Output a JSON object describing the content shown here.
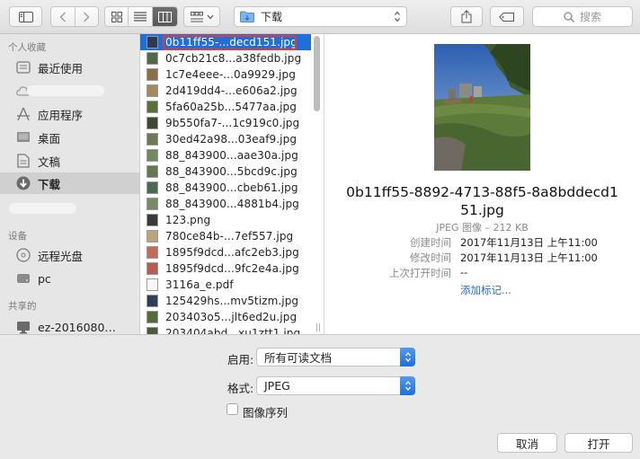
{
  "toolbar": {
    "sidebar_toggle_icon": "sidebar-icon",
    "back_icon": "chevron-left-icon",
    "forward_icon": "chevron-right-icon",
    "view_icons": [
      "icon-view-icon",
      "list-view-icon",
      "column-view-icon"
    ],
    "active_view": "column-view-icon",
    "group_icon": "grid-group-icon",
    "location": "下载",
    "share_icon": "share-icon",
    "tag_icon": "tag-icon",
    "search_placeholder": "搜索"
  },
  "sidebar": {
    "favorites_header": "个人收藏",
    "favorites": [
      {
        "label": "最近使用",
        "icon": "recents-icon"
      },
      {
        "label": "",
        "icon": "cloud-icon"
      },
      {
        "label": "应用程序",
        "icon": "applications-icon"
      },
      {
        "label": "桌面",
        "icon": "desktop-icon"
      },
      {
        "label": "文稿",
        "icon": "documents-icon"
      },
      {
        "label": "下载",
        "icon": "downloads-icon",
        "selected": true
      }
    ],
    "devices_header": "设备",
    "devices": [
      {
        "label": "远程光盘",
        "icon": "disc-icon"
      },
      {
        "label": "pc",
        "icon": "drive-icon"
      }
    ],
    "shared_header": "共享的",
    "shared": [
      {
        "label": "ez-2016080…",
        "icon": "monitor-icon"
      }
    ]
  },
  "files": [
    {
      "name": "0b11ff55-...decd151.jpg",
      "selected": true,
      "thumb": "#2c3a55"
    },
    {
      "name": "0c7cb21c8...a38fedb.jpg",
      "thumb": "#4f6b45"
    },
    {
      "name": "1c7e4eee-...0a9929.jpg",
      "thumb": "#8a6f4a"
    },
    {
      "name": "2d419dd4-...e606a2.jpg",
      "thumb": "#a48a5e"
    },
    {
      "name": "5fa60a25b...5477aa.jpg",
      "thumb": "#5b6f3a"
    },
    {
      "name": "9b550fa7-...1c919c0.jpg",
      "thumb": "#3d4a30"
    },
    {
      "name": "30ed42a98...03eaf9.jpg",
      "thumb": "#6d7a55"
    },
    {
      "name": "88_843900...aae30a.jpg",
      "thumb": "#6f8b5b"
    },
    {
      "name": "88_843900...5bcd9c.jpg",
      "thumb": "#5f7a4d"
    },
    {
      "name": "88_843900...cbeb61.jpg",
      "thumb": "#4a6a52"
    },
    {
      "name": "88_843900...4881b4.jpg",
      "thumb": "#7a8a64"
    },
    {
      "name": "123.png",
      "thumb": "#3a3a3a"
    },
    {
      "name": "780ce84b-...7ef557.jpg",
      "thumb": "#b9a67a"
    },
    {
      "name": "1895f9dcd...afc2eb3.jpg",
      "thumb": "#c46a5a"
    },
    {
      "name": "1895f9dcd...9fc2e4a.jpg",
      "thumb": "#b85c4c"
    },
    {
      "name": "3116a_e.pdf",
      "thumb": "doc"
    },
    {
      "name": "125429hs...mv5tizm.jpg",
      "thumb": "#2f3f55"
    },
    {
      "name": "203403o5...jlt6ed2u.jpg",
      "thumb": "#556b3a"
    },
    {
      "name": "203404abd...xu1ztt1.jpg",
      "thumb": "#4a5a3a"
    }
  ],
  "preview": {
    "filename_line1": "0b11ff55-8892-4713-88f5-8a8bddecd1",
    "filename_line2": "51.jpg",
    "kind_size": "JPEG 图像 – 212 KB",
    "info": [
      {
        "key": "创建时间",
        "value": "2017年11月13日 上午11:00"
      },
      {
        "key": "修改时间",
        "value": "2017年11月13日 上午11:00"
      },
      {
        "key": "上次打开时间",
        "value": "--"
      }
    ],
    "add_tags": "添加标记..."
  },
  "options": {
    "enable_label": "启用:",
    "enable_value": "所有可读文档",
    "format_label": "格式:",
    "format_value": "JPEG",
    "sequence_label": "图像序列"
  },
  "buttons": {
    "cancel": "取消",
    "open": "打开"
  },
  "colors": {
    "selection": "#1e6fd9",
    "accent": "#2b6fd6",
    "highlight_box": "#e53935"
  }
}
